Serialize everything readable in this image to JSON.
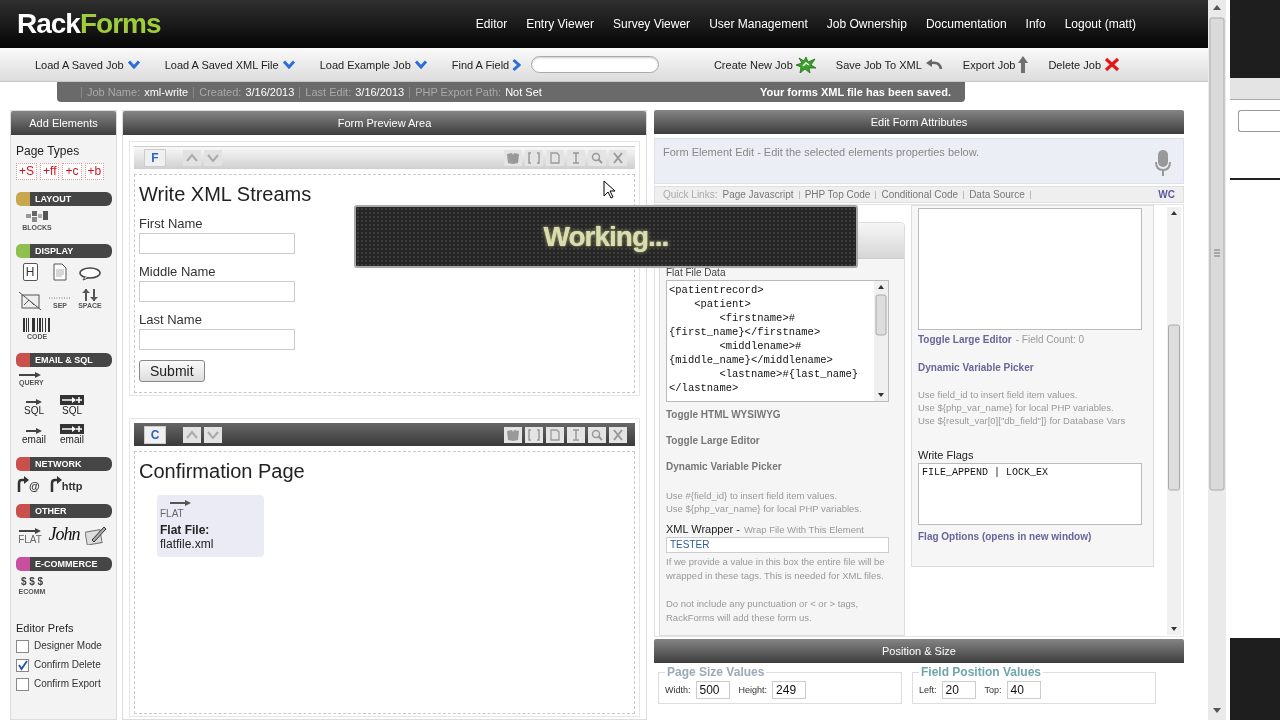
{
  "header": {
    "logo": [
      "Rack",
      "Forms"
    ],
    "nav": [
      "Editor",
      "Entry Viewer",
      "Survey Viewer",
      "User Management",
      "Job Ownership",
      "Documentation",
      "Info",
      "Logout (matt)"
    ]
  },
  "toolbar": {
    "left": [
      {
        "label": "Load A Saved Job",
        "kind": "dropdown"
      },
      {
        "label": "Load A Saved XML File",
        "kind": "dropdown"
      },
      {
        "label": "Load Example Job",
        "kind": "dropdown"
      },
      {
        "label": "Find A Field",
        "kind": "find"
      }
    ],
    "right": [
      {
        "label": "Create New Job",
        "kind": "create"
      },
      {
        "label": "Save Job To XML",
        "kind": "save"
      },
      {
        "label": "Export Job",
        "kind": "export"
      },
      {
        "label": "Delete Job",
        "kind": "delete"
      }
    ]
  },
  "job_bar": {
    "fields": [
      {
        "label": "Job Name:",
        "value": "xml-write"
      },
      {
        "label": "Created:",
        "value": "3/16/2013"
      },
      {
        "label": "Last Edit:",
        "value": "3/16/2013"
      },
      {
        "label": "PHP Export Path:",
        "value": "Not Set"
      }
    ],
    "message": "Your forms XML file has been saved."
  },
  "sidebar": {
    "title": "Add Elements",
    "page_types_label": "Page Types",
    "page_types": [
      "+S",
      "+ff",
      "+c",
      "+b"
    ],
    "groups": [
      {
        "title": "LAYOUT",
        "color": "#c8a84e",
        "items": [
          {
            "kind": "blocks",
            "label": "BLOCKS"
          }
        ]
      },
      {
        "title": "DISPLAY",
        "color": "#8dc04c",
        "items": [
          {
            "kind": "heading",
            "glyph": "H"
          },
          {
            "kind": "document"
          },
          {
            "kind": "bubble"
          },
          {
            "kind": "image"
          },
          {
            "kind": "separator",
            "label": "SEP"
          },
          {
            "kind": "spacer",
            "label": "SPACE"
          },
          {
            "kind": "barcode",
            "label": "CODE"
          }
        ]
      },
      {
        "title": "EMAIL & SQL",
        "color": "#c9504c",
        "items": [
          {
            "kind": "query",
            "label": "QUERY"
          },
          {
            "kind": "arrow",
            "label": "SQL"
          },
          {
            "kind": "arrow-box",
            "label": "SQL"
          },
          {
            "kind": "arrow",
            "label": "email"
          },
          {
            "kind": "arrow-box",
            "label": "email"
          }
        ]
      },
      {
        "title": "NETWORK",
        "color": "#c9504c",
        "items": [
          {
            "kind": "redirect",
            "glyph": "@"
          },
          {
            "kind": "redirect",
            "glyph": "http"
          }
        ]
      },
      {
        "title": "OTHER",
        "color": "#c9504c",
        "items": [
          {
            "kind": "flat",
            "label": "FLAT"
          },
          {
            "kind": "signature",
            "glyph": "John"
          },
          {
            "kind": "pencil"
          }
        ]
      },
      {
        "title": "E-COMMERCE",
        "color": "#c84fa0",
        "items": [
          {
            "kind": "cash",
            "glyph": "$ $ $",
            "label": "ECOMM"
          }
        ]
      }
    ],
    "prefs_label": "Editor Prefs",
    "prefs": [
      {
        "label": "Designer Mode",
        "checked": false
      },
      {
        "label": "Confirm Delete",
        "checked": true
      },
      {
        "label": "Confirm Export",
        "checked": false
      }
    ]
  },
  "preview": {
    "title": "Form Preview Area",
    "pages": [
      {
        "badge": "F",
        "selected": true,
        "title": "Write XML Streams",
        "elements": [
          {
            "kind": "text",
            "label": "First Name"
          },
          {
            "kind": "text",
            "label": "Middle Name"
          },
          {
            "kind": "text",
            "label": "Last Name"
          },
          {
            "kind": "submit",
            "label": "Submit"
          }
        ]
      },
      {
        "badge": "C",
        "selected": false,
        "title": "Confirmation Page",
        "elements": [
          {
            "kind": "flat",
            "tag": "FLAT",
            "label": "Flat File:",
            "value": "flatfile.xml"
          }
        ]
      }
    ]
  },
  "editor": {
    "title": "Edit Form Attributes",
    "description": "Form Element Edit - Edit the selected elements properties below.",
    "quick_links_label": "Quick Links:",
    "quick_links": [
      "Page Javascript",
      "PHP Top Code",
      "Conditional Code",
      "Data Source"
    ],
    "corner_link": "WC",
    "left": {
      "data_label": "Flat File Data",
      "code": [
        "<patientrecord>",
        "    <patient>",
        "        <firstname>#",
        "{first_name}</firstname>",
        "        <middlename>#",
        "{middle_name}</middlename>",
        "        <lastname>#{last_name}",
        "</lastname>"
      ],
      "links": [
        "Toggle HTML WYSIWYG",
        "Toggle Large Editor",
        "Dynamic Variable Picker"
      ],
      "help": [
        "Use #{field_id} to insert field item values.",
        "Use ${php_var_name} for local PHP variables."
      ],
      "wrapper_label": "XML Wrapper -",
      "wrapper_hint": "Wrap File With This Element",
      "wrapper_value": "TESTER",
      "notes": [
        "If we provide a value in this box the entire file will be wrapped in these tags. This is needed for XML files.",
        "Do not include any punctuation or < or > tags, RackForms will add these form us."
      ]
    },
    "right": {
      "editor_link": "Toggle Large Editor",
      "field_count": "- Field Count: 0",
      "picker_link": "Dynamic Variable Picker",
      "help": [
        "Use field_id to insert field item values.",
        "Use ${php_var_name} for local PHP variables.",
        "Use ${result_var[0][\"db_field\"]} for Database Vars"
      ],
      "flags_label": "Write Flags",
      "flags_value": "FILE_APPEND | LOCK_EX",
      "flags_link": "Flag Options (opens in new window)"
    }
  },
  "position": {
    "title": "Position & Size",
    "groups": [
      {
        "legend": "Page Size Values",
        "fields": [
          {
            "label": "Width:",
            "value": "500"
          },
          {
            "label": "Height:",
            "value": "249"
          }
        ]
      },
      {
        "legend": "Field Position Values",
        "fields": [
          {
            "label": "Left:",
            "value": "20"
          },
          {
            "label": "Top:",
            "value": "40"
          }
        ]
      }
    ]
  },
  "overlay": {
    "text": "Working..."
  }
}
